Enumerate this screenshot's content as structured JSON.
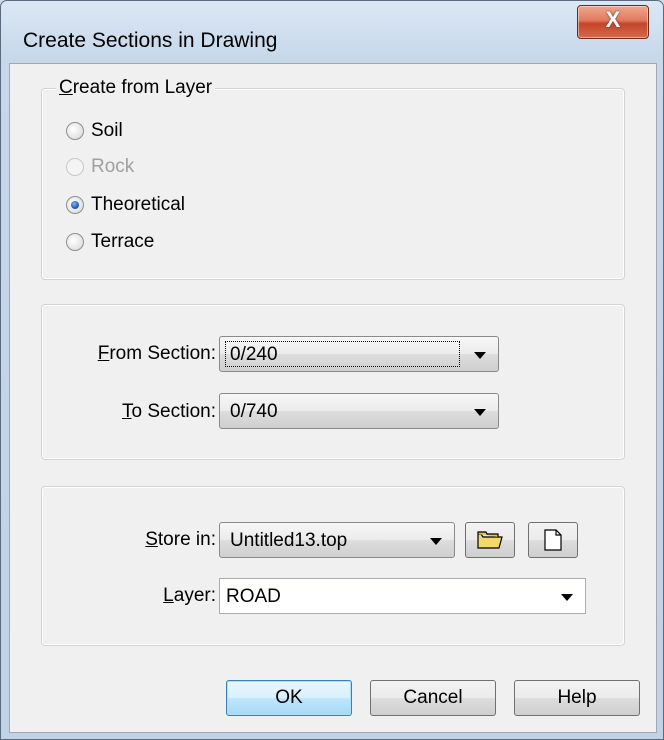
{
  "window": {
    "title": "Create Sections  in Drawing",
    "close_glyph": "X"
  },
  "create_from_layer": {
    "title_mnemonic": "C",
    "title_rest": "reate from Layer",
    "options": [
      {
        "label": "Soil",
        "checked": false,
        "disabled": false
      },
      {
        "label": "Rock",
        "checked": false,
        "disabled": true
      },
      {
        "label": "Theoretical",
        "checked": true,
        "disabled": false
      },
      {
        "label": "Terrace",
        "checked": false,
        "disabled": false
      }
    ]
  },
  "sections": {
    "from_mnemonic": "F",
    "from_rest": "rom Section:",
    "from_value": "0/240",
    "to_mnemonic": "T",
    "to_rest": "o Section:",
    "to_value": "0/740"
  },
  "storage": {
    "store_mnemonic": "S",
    "store_rest": "tore in:",
    "store_value": "Untitled13.top",
    "browse_icon": "folder-icon",
    "new_icon": "new-document-icon",
    "layer_mnemonic": "L",
    "layer_rest": "ayer:",
    "layer_value": "ROAD"
  },
  "buttons": {
    "ok": "OK",
    "cancel": "Cancel",
    "help": "Help"
  }
}
